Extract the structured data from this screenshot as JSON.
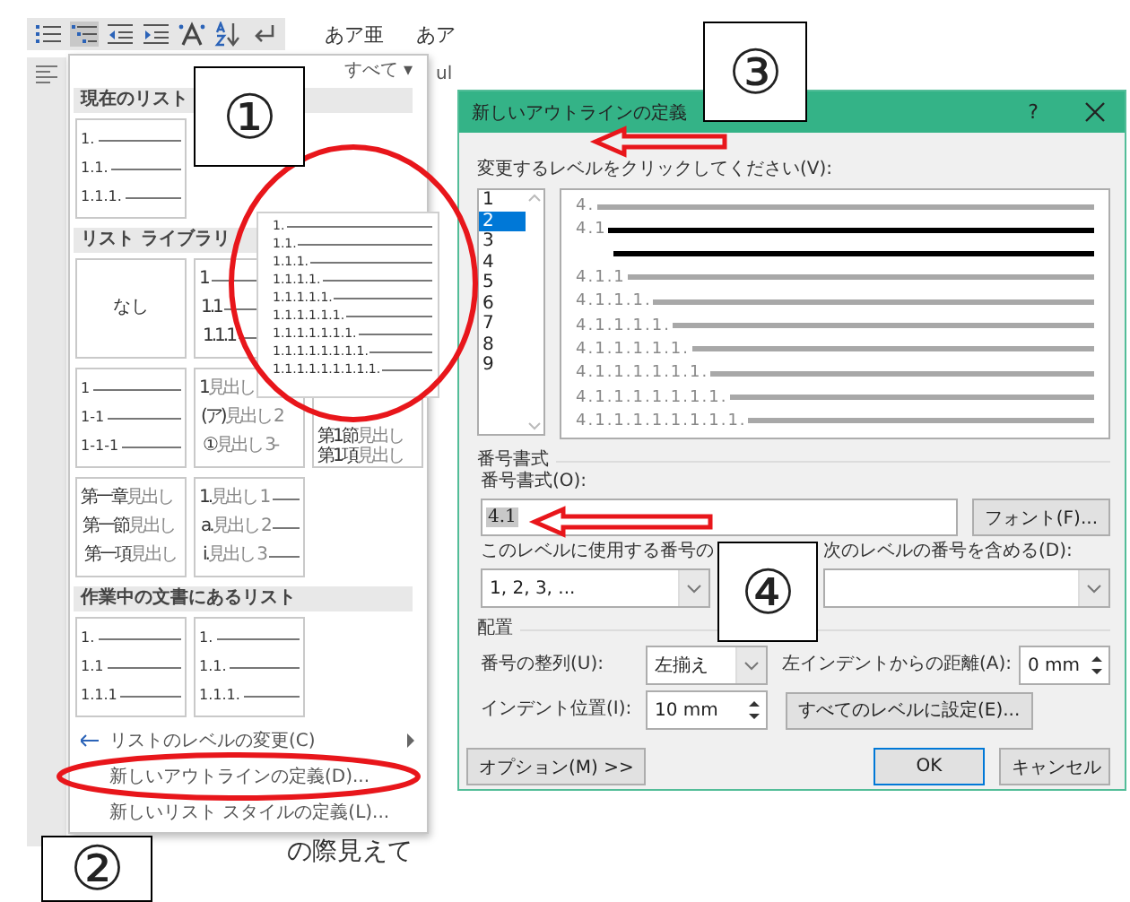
{
  "ribbon": {
    "style_samples": [
      "あア亜",
      "あア"
    ],
    "fragment": "ul"
  },
  "document": {
    "text": "の際見えて"
  },
  "menu": {
    "filter": "すべて",
    "filter_caret": "▾",
    "sections": [
      {
        "title": "現在のリスト",
        "thumbnails": [
          {
            "kind": "flat",
            "lines": [
              {
                "num": "1.",
                "rule": true
              },
              {
                "num": "1.1.",
                "rule": true
              },
              {
                "num": "1.1.1.",
                "rule": true
              }
            ]
          }
        ]
      },
      {
        "title": "リスト ライブラリ",
        "thumbnails": [
          {
            "kind": "none",
            "lines": [
              {
                "num": "なし"
              }
            ]
          },
          {
            "kind": "indented",
            "lines": [
              {
                "num": "1",
                "rule": true
              },
              {
                "num": "1.1",
                "rule": true
              },
              {
                "num": "1.1.1",
                "rule": true
              }
            ]
          },
          {
            "kind": "covered"
          },
          {
            "kind": "flat",
            "lines": [
              {
                "num": "1",
                "rule": true
              },
              {
                "num": "1-1",
                "rule": true
              },
              {
                "num": "1-1-1",
                "rule": true
              }
            ]
          },
          {
            "kind": "indented",
            "lines": [
              {
                "num": "1",
                "note": "見出し"
              },
              {
                "num": "(ア)",
                "note": "見出し 2"
              },
              {
                "num": "①",
                "note": "見出し 3-"
              }
            ]
          },
          {
            "kind": "partial",
            "lines": [
              {
                "num": "第1節",
                "note": "見出し"
              },
              {
                "num": "第1項",
                "note": "見出し"
              }
            ]
          },
          {
            "kind": "indented",
            "lines": [
              {
                "num": "第一章",
                "note": "見出し"
              },
              {
                "num": "第一節",
                "note": "見出し"
              },
              {
                "num": "第一項",
                "note": "見出し"
              }
            ]
          },
          {
            "kind": "indented",
            "lines": [
              {
                "num": "1.",
                "note": "見出し 1",
                "rule": true
              },
              {
                "num": "a.",
                "note": "見出し 2",
                "rule": true
              },
              {
                "num": "i.",
                "note": "見出し 3",
                "rule": true
              }
            ]
          }
        ]
      },
      {
        "title": "作業中の文書にあるリスト",
        "thumbnails": [
          {
            "kind": "flat",
            "lines": [
              {
                "num": "1.",
                "rule": true
              },
              {
                "num": "1.1",
                "rule": true
              },
              {
                "num": "1.1.1",
                "rule": true
              }
            ]
          },
          {
            "kind": "flat",
            "lines": [
              {
                "num": "1.",
                "rule": true
              },
              {
                "num": "1.1.",
                "rule": true
              },
              {
                "num": "1.1.1.",
                "rule": true
              }
            ]
          }
        ]
      }
    ],
    "items": [
      {
        "label": "リストのレベルの変更(C)",
        "submenu": true
      },
      {
        "label": "新しいアウトラインの定義(D)...",
        "submenu": false
      },
      {
        "label": "新しいリスト スタイルの定義(L)...",
        "submenu": false
      }
    ],
    "preview": [
      "1.",
      "1.1.",
      "1.1.1.",
      "1.1.1.1.",
      "1.1.1.1.1.",
      "1.1.1.1.1.1.",
      "1.1.1.1.1.1.1.",
      "1.1.1.1.1.1.1.1.",
      "1.1.1.1.1.1.1.1.1."
    ]
  },
  "dialog": {
    "title": "新しいアウトラインの定義",
    "help": "?",
    "level_label": "変更するレベルをクリックしてください(V):",
    "levels": [
      {
        "label": "1",
        "selected": false
      },
      {
        "label": "2",
        "selected": true
      },
      {
        "label": "3",
        "selected": false
      },
      {
        "label": "4",
        "selected": false
      },
      {
        "label": "5",
        "selected": false
      },
      {
        "label": "6",
        "selected": false
      },
      {
        "label": "7",
        "selected": false
      },
      {
        "label": "8",
        "selected": false
      },
      {
        "label": "9",
        "selected": false
      }
    ],
    "preview": [
      {
        "num": "4.",
        "current": false
      },
      {
        "num": "4.1",
        "current": true
      },
      {
        "current": true
      },
      {
        "num": "4.1.1",
        "current": false
      },
      {
        "num": "4.1.1.1.",
        "current": false
      },
      {
        "num": "4.1.1.1.1.",
        "current": false
      },
      {
        "num": "4.1.1.1.1.1.",
        "current": false
      },
      {
        "num": "4.1.1.1.1.1.1.",
        "current": false
      },
      {
        "num": "4.1.1.1.1.1.1.1.",
        "current": false
      },
      {
        "num": "4.1.1.1.1.1.1.1.1.",
        "current": false
      }
    ],
    "format_section": "番号書式",
    "format_label": "番号書式(O):",
    "format_value": "4.1",
    "font_button": "フォント(F)...",
    "style_label": "このレベルに使用する番号の",
    "style_value": "1, 2, 3, ...",
    "include_label": "次のレベルの番号を含める(D):",
    "position_section": "配置",
    "align_label": "番号の整列(U):",
    "align_value": "左揃え",
    "left_indent_label": "左インデントからの距離(A):",
    "left_indent_value": "0 mm",
    "indent_label": "インデント位置(I):",
    "indent_value": "10 mm",
    "all_levels_button": "すべてのレベルに設定(E)...",
    "options_button": "オプション(M) >>",
    "ok_button": "OK",
    "cancel_button": "キャンセル"
  },
  "annotations": [
    "①",
    "②",
    "③",
    "④"
  ]
}
